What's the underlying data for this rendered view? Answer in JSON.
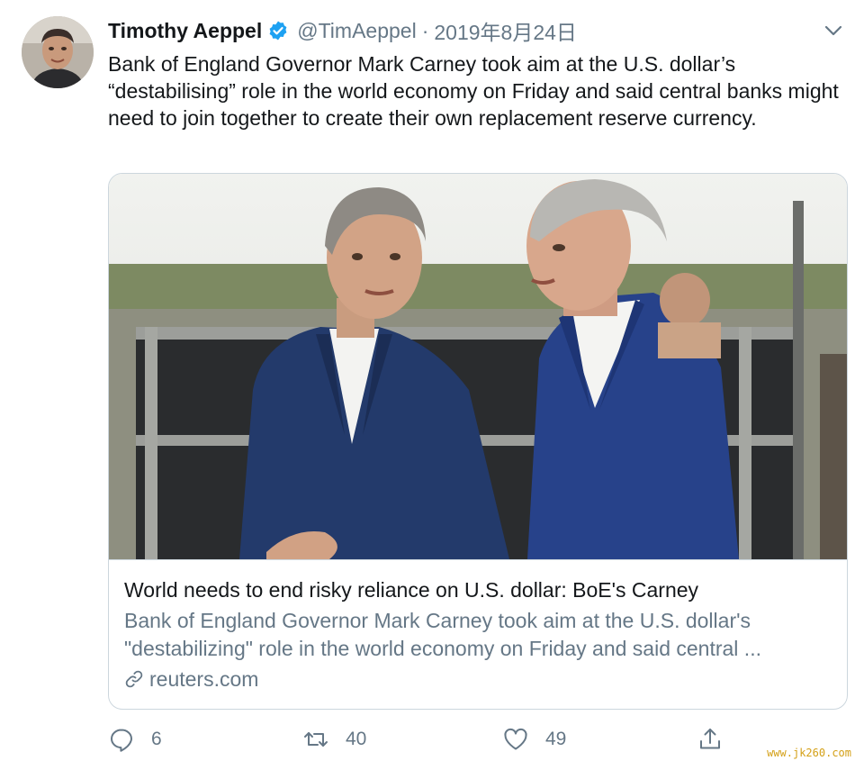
{
  "author": {
    "display_name": "Timothy Aeppel",
    "handle": "@TimAeppel",
    "separator": "·",
    "date": "2019年8月24日",
    "verified": true,
    "avatar_icon": "user-photo"
  },
  "tweet": {
    "text": "Bank of England Governor Mark Carney took aim at the U.S. dollar’s “destabilising” role in the world economy on Friday and said central banks might need to join together to create their own replacement reserve currency."
  },
  "card": {
    "image_icon": "news-photo",
    "title": "World needs to end risky reliance on U.S. dollar: BoE's Carney",
    "description_line1": "Bank of England Governor Mark Carney took aim at the U.S. dollar's",
    "description_line2": "\"destabilizing\" role in the world economy on Friday and said central ...",
    "domain": "reuters.com",
    "domain_icon": "link-icon"
  },
  "actions": {
    "reply_count": "6",
    "retweet_count": "40",
    "like_count": "49"
  },
  "watermark": "www.jk260.com",
  "colors": {
    "text": "#14171a",
    "secondary": "#657786",
    "verified": "#1da1f2",
    "border": "#ccd6dd"
  }
}
